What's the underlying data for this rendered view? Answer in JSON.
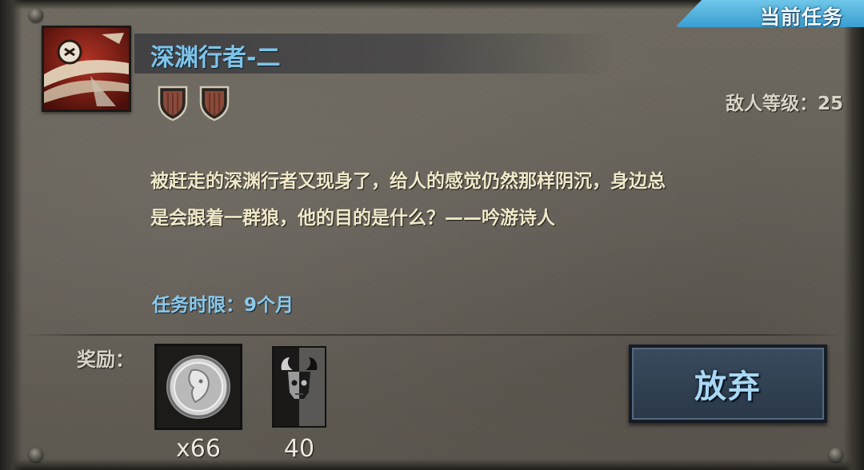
{
  "header": {
    "tab_label": "当前任务"
  },
  "quest": {
    "icon": "claw-slash-icon",
    "title": "深渊行者-二",
    "difficulty_shields": [
      {
        "icon": "shield-icon"
      },
      {
        "icon": "shield-icon"
      }
    ],
    "enemy_level_label": "敌人等级：25",
    "description": [
      "被赶走的深渊行者又现身了，给人的感觉仍然那样阴沉，身边总",
      "是会跟着一群狼，他的目的是什么？——吟游诗人"
    ],
    "time_limit": "任务时限：9个月"
  },
  "rewards": {
    "label": "奖励：",
    "items": [
      {
        "icon": "silver-coin-icon",
        "count": "x66"
      },
      {
        "icon": "horned-skull-banner-icon",
        "count": "40"
      }
    ]
  },
  "actions": {
    "abandon_label": "放弃"
  },
  "colors": {
    "title": "#7ec4ea",
    "description": "#efe9c9",
    "time_limit": "#8dc9ea",
    "tab": "#3a9ed1",
    "button": "#2f3e50"
  }
}
